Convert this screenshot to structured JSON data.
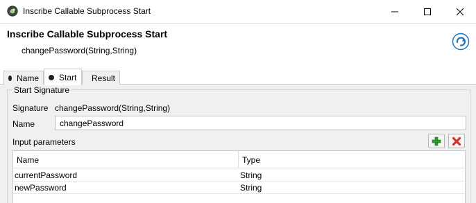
{
  "window": {
    "title": "Inscribe Callable Subprocess Start"
  },
  "header": {
    "title": "Inscribe Callable Subprocess Start",
    "subtitle": "changePassword(String,String)"
  },
  "tabs": [
    {
      "label": "Name",
      "active": false
    },
    {
      "label": "Start",
      "active": true
    },
    {
      "label": "Result",
      "active": false
    }
  ],
  "start": {
    "group_title": "Start Signature",
    "signature_label": "Signature",
    "signature_value": "changePassword(String,String)",
    "name_label": "Name",
    "name_value": "changePassword",
    "params_label": "Input parameters",
    "table": {
      "columns": [
        "Name",
        "Type"
      ],
      "rows": [
        {
          "name": "currentPassword",
          "type": "String"
        },
        {
          "name": "newPassword",
          "type": "String"
        }
      ]
    }
  },
  "colors": {
    "accent_blue": "#1e73be",
    "add_green": "#2e9e2e",
    "delete_red": "#d9342b"
  }
}
